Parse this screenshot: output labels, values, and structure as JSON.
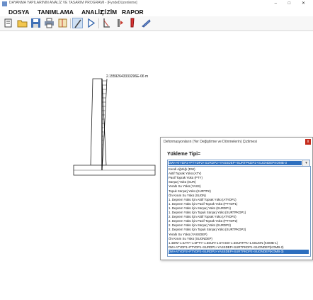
{
  "window": {
    "title": "DAYANMA YAPILARININ ANALİZ VE TASARIM PROGRAMI - [FyndeDüzenleme]",
    "controls": "– □ ✕"
  },
  "menu": [
    "DOSYA",
    "TANIMLAMA",
    "ANALİZ",
    "ÇİZİM",
    "RAPOR"
  ],
  "toolbar": {
    "icons": [
      "new-file-icon",
      "open-folder-icon",
      "save-icon",
      "print-icon",
      "wall-model-icon",
      "select-pointer-icon",
      "play-icon",
      "analysis-icon",
      "stabilize-icon",
      "reinforcement-icon",
      "drawing-icon"
    ]
  },
  "drawing": {
    "deformation_label": "2.15592643333296E-06  m"
  },
  "dialog": {
    "title": "Deformasyonların (Yer Değiştirme ve Dönmelerin) Çizilmesi",
    "close_label": "x",
    "load_type_label": "Yükleme Tipi=",
    "selected_value": "DW+ATYDP2+PTYDP2+SURDP2+YASSDEP+SURTPKDP2+SUONDEPKOMB-3",
    "dropdown_arrow": "▾",
    "options": [
      "Kendi Ağırlığı (DW)",
      "Aktif Toprak Yükü (ATY)",
      "Pasif Toprak Yükü (PTY)",
      "Sürşarj Yükü (SUR)",
      "Yeraltı Su Yükü (YASS)",
      "Topuk Sürşarj Yükü (SURTPK)",
      "Ön Kısım Su Yükü (SUON)",
      "1. Deprem Yükü İçin Aktif Toprak Yükü (ATYDP1)",
      "1. Deprem Yükü İçin Pasif Toprak Yükü (PTYDP1)",
      "1. Deprem Yükü İçin Sürşarj Yükü (SURDP1)",
      "1. Deprem Yükü İçin Topuk Sürşarj Yükü (SURTPKDP1)",
      "2. Deprem Yükü İçin Aktif Toprak Yükü (ATYDP2)",
      "2. Deprem Yükü İçin Pasif Toprak Yükü (PTYDP2)",
      "2. Deprem Yükü İçin Sürşarj Yükü (SURDP2)",
      "2. Deprem Yükü İçin Topuk Sürşarj Yükü (SURTPKDP2)",
      "Yeraltı Su Yükü (YASSDEP)",
      "Ön Kısım Su Yükü (SUONDEP)",
      "1.4DW+1.6ATY+1.6PTY+1.6SUR+1.6YASS+1.6SURTPK+1.6SUON (KOMB-1)",
      "DW+ATYDP1+PTYDP1+SURDP1+YASSDEP+SURTPKDP1+SUONDEP(KOMB-2)",
      "DW+ATYDP2+PTYDP2+SURDP2+YASSDEP+SURTPKDP2+SUONDEP(KOMB-3)"
    ],
    "selected_index": 19
  },
  "colors": {
    "selection": "#2d6fbf",
    "close_button": "#c42b1c",
    "structure": "#222222"
  }
}
